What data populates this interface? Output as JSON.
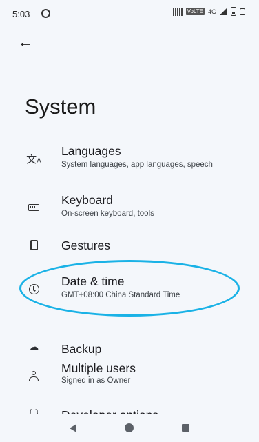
{
  "status_bar": {
    "time": "5:03",
    "network": "4G"
  },
  "page": {
    "title": "System"
  },
  "items": [
    {
      "label": "Languages",
      "sub": "System languages, app languages, speech",
      "icon": "translate-icon"
    },
    {
      "label": "Keyboard",
      "sub": "On-screen keyboard, tools",
      "icon": "keyboard-icon"
    },
    {
      "label": "Gestures",
      "sub": "",
      "icon": "gestures-icon"
    },
    {
      "label": "Date & time",
      "sub": "GMT+08:00 China Standard Time",
      "icon": "clock-icon"
    },
    {
      "label": "Backup",
      "sub": "",
      "icon": "cloud-upload-icon"
    },
    {
      "label": "Multiple users",
      "sub": "Signed in as Owner",
      "icon": "person-icon"
    },
    {
      "label": "Developer options",
      "sub": "",
      "icon": "braces-icon"
    }
  ],
  "colors": {
    "background": "#f4f7fb",
    "highlight": "#1ab2e6"
  }
}
